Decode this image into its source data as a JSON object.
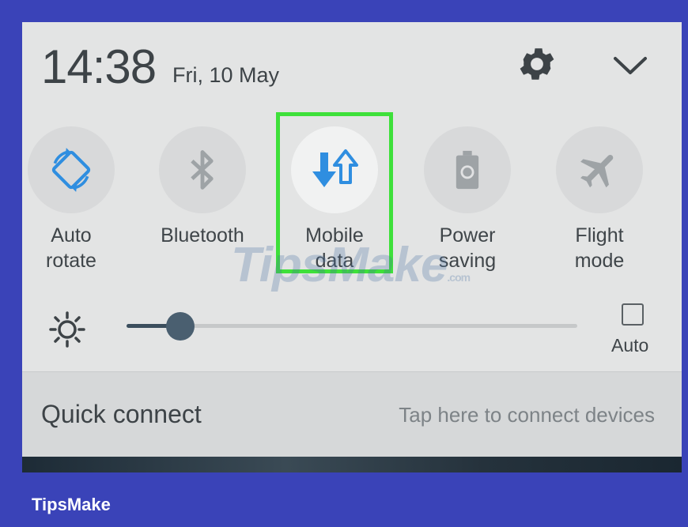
{
  "status": {
    "time": "14:38",
    "date": "Fri, 10 May"
  },
  "header_icons": {
    "settings": "gear-icon",
    "expand": "chevron-down-icon"
  },
  "tiles": [
    {
      "label": "Auto\nrotate",
      "icon": "auto-rotate-icon",
      "active": false
    },
    {
      "label": "Bluetooth",
      "icon": "bluetooth-icon",
      "active": false
    },
    {
      "label": "Mobile\ndata",
      "icon": "mobile-data-icon",
      "active": true
    },
    {
      "label": "Power\nsaving",
      "icon": "power-saving-icon",
      "active": false
    },
    {
      "label": "Flight\nmode",
      "icon": "flight-mode-icon",
      "active": false
    }
  ],
  "brightness": {
    "level": 0.12,
    "auto_label": "Auto",
    "auto_checked": false
  },
  "quick_connect": {
    "title": "Quick connect",
    "hint": "Tap here to connect devices"
  },
  "watermark": {
    "text": "TipsMake",
    "suffix": ".com"
  },
  "brand": "TipsMake",
  "colors": {
    "highlight": "#3ee03a",
    "accent": "#2f8ee0",
    "frame": "#3a43b8"
  }
}
